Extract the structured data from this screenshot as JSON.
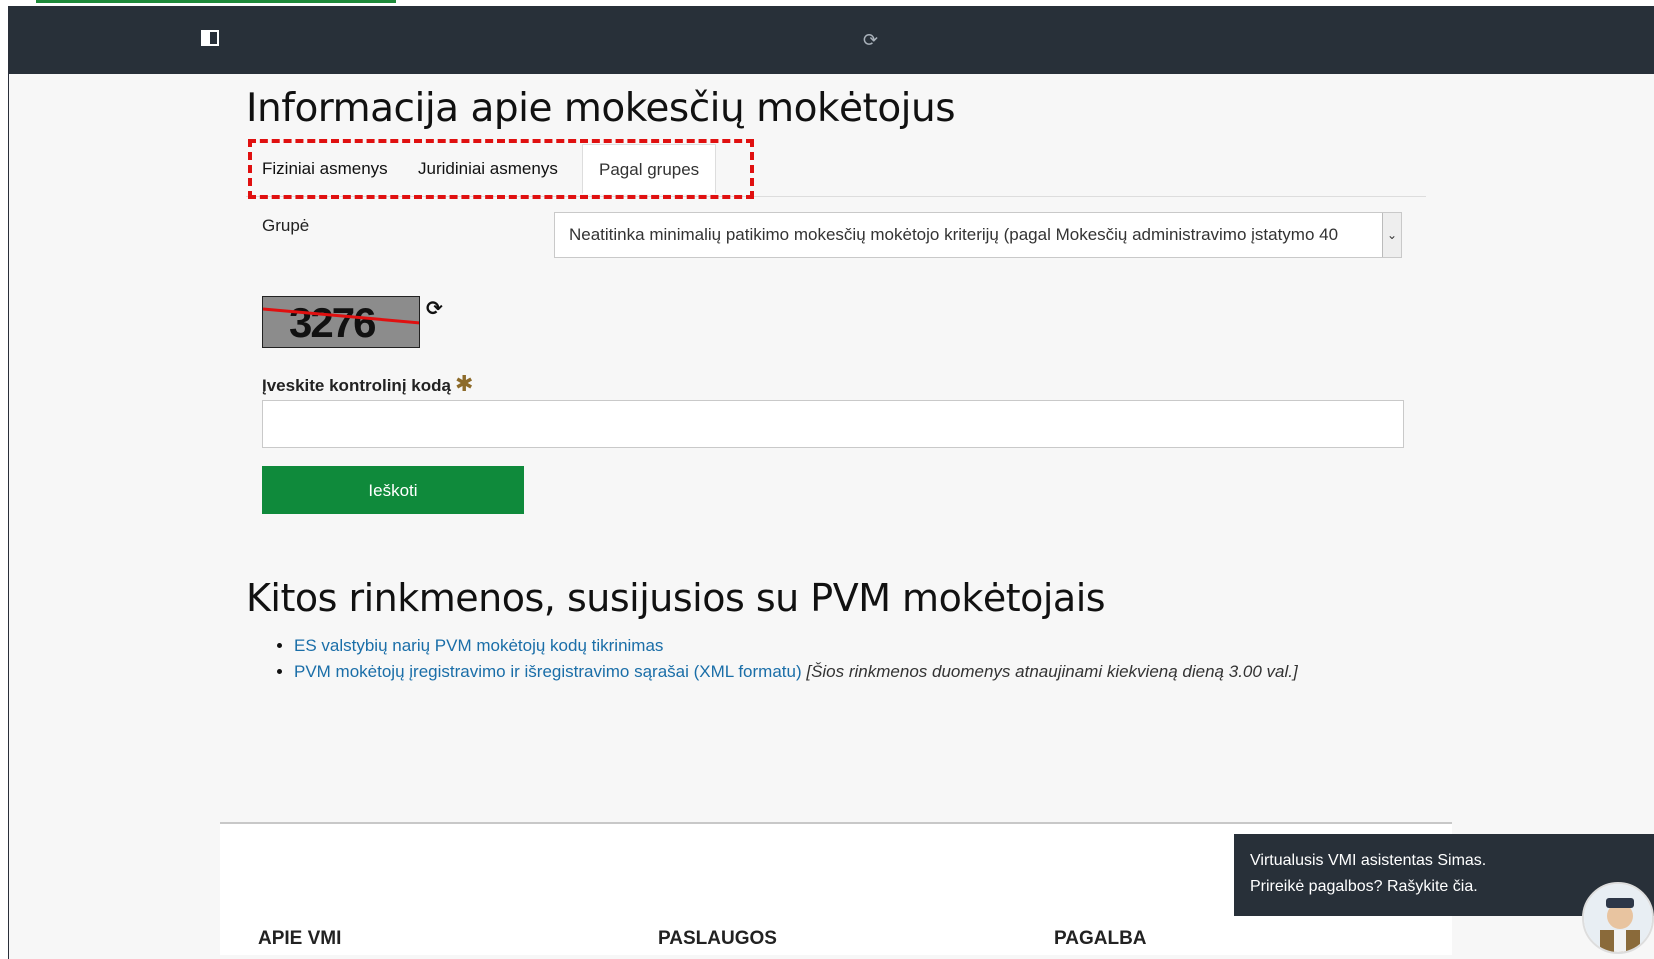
{
  "header": {
    "sidebar_toggle_icon": "panel-icon",
    "reload_icon": "reload-icon"
  },
  "main": {
    "title": "Informacija apie mokesčių mokėtojus",
    "tabs": [
      {
        "label": "Fiziniai asmenys",
        "active": false
      },
      {
        "label": "Juridiniai asmenys",
        "active": false
      },
      {
        "label": "Pagal grupes",
        "active": true
      }
    ],
    "group_label": "Grupė",
    "group_selected": "Neatitinka minimalių patikimo mokesčių mokėtojo kriterijų (pagal Mokesčių administravimo įstatymo 40",
    "captcha_text": "3276",
    "code_label": "Įveskite kontrolinį kodą",
    "code_value": "",
    "search_button": "Ieškoti"
  },
  "other": {
    "title": "Kitos rinkmenos, susijusios su PVM mokėtojais",
    "links": [
      {
        "text": "ES valstybių narių PVM mokėtojų kodų tikrinimas",
        "note": ""
      },
      {
        "text": "PVM mokėtojų įregistravimo ir išregistravimo sąrašai (XML formatu)",
        "note": "[Šios rinkmenos duomenys atnaujinami kiekvieną dieną 3.00 val.]"
      }
    ]
  },
  "footer": {
    "col1": "APIE VMI",
    "col2": "PASLAUGOS",
    "col3": "PAGALBA"
  },
  "chat": {
    "line1": "Virtualusis VMI asistentas Simas.",
    "line2": "Prireikė pagalbos? Rašykite čia."
  },
  "colors": {
    "appbar": "#283039",
    "button_green": "#0f8a3b",
    "link_blue": "#1a6ea8",
    "highlight_red": "#e01010"
  }
}
